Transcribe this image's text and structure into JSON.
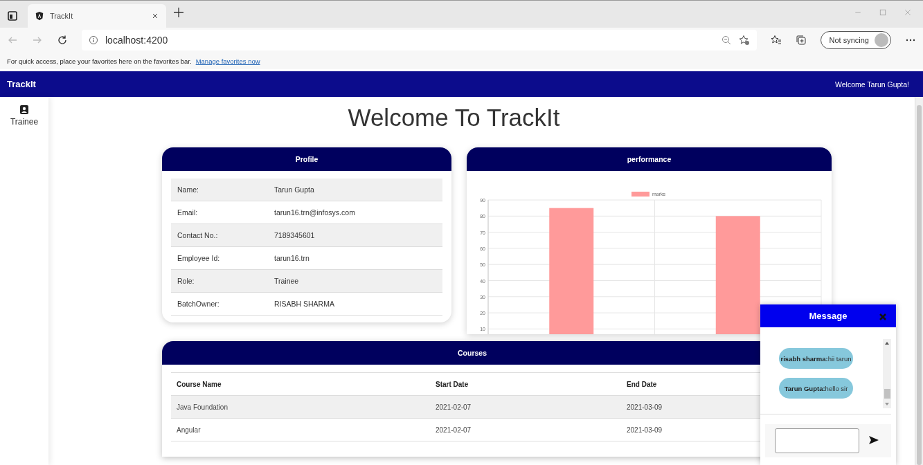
{
  "browser": {
    "tab_title": "TrackIt",
    "address": "localhost:4200",
    "profile_button": "Not syncing",
    "favorites_bar": {
      "text": "For quick access, place your favorites here on the favorites bar.",
      "link": "Manage favorites now"
    }
  },
  "app_bar": {
    "title": "TrackIt",
    "greeting": "Welcome Tarun Gupta!"
  },
  "sidebar": {
    "items": [
      {
        "label": "Trainee"
      }
    ]
  },
  "heading": "Welcome To TrackIt",
  "profile": {
    "title": "Profile",
    "rows": [
      {
        "label": "Name:",
        "value": "Tarun Gupta"
      },
      {
        "label": "Email:",
        "value": "tarun16.trn@infosys.com"
      },
      {
        "label": "Contact No.:",
        "value": "7189345601"
      },
      {
        "label": "Employee Id:",
        "value": "tarun16.trn"
      },
      {
        "label": "Role:",
        "value": "Trainee"
      },
      {
        "label": "BatchOwner:",
        "value": "RISABH SHARMA"
      }
    ]
  },
  "performance": {
    "title": "performance",
    "chart_data": {
      "type": "bar",
      "grid": true,
      "ylim": [
        9.5,
        90
      ],
      "yticks": [
        10,
        20,
        30,
        40,
        50,
        60,
        70,
        80,
        90
      ],
      "series": [
        {
          "name": "marks",
          "color": "#ff9a9a",
          "values": [
            85,
            80
          ]
        }
      ]
    }
  },
  "courses": {
    "title": "Courses",
    "columns": [
      "Course Name",
      "Start Date",
      "End Date"
    ],
    "rows": [
      [
        "Java Foundation",
        "2021-02-07",
        "2021-03-09"
      ],
      [
        "Angular",
        "2021-02-07",
        "2021-03-09"
      ]
    ]
  },
  "chat": {
    "title": "Message",
    "messages": [
      {
        "text": "**risabh sharma:**hii tarun"
      },
      {
        "text": "**Tarun Gupta:**hello sir"
      }
    ]
  }
}
